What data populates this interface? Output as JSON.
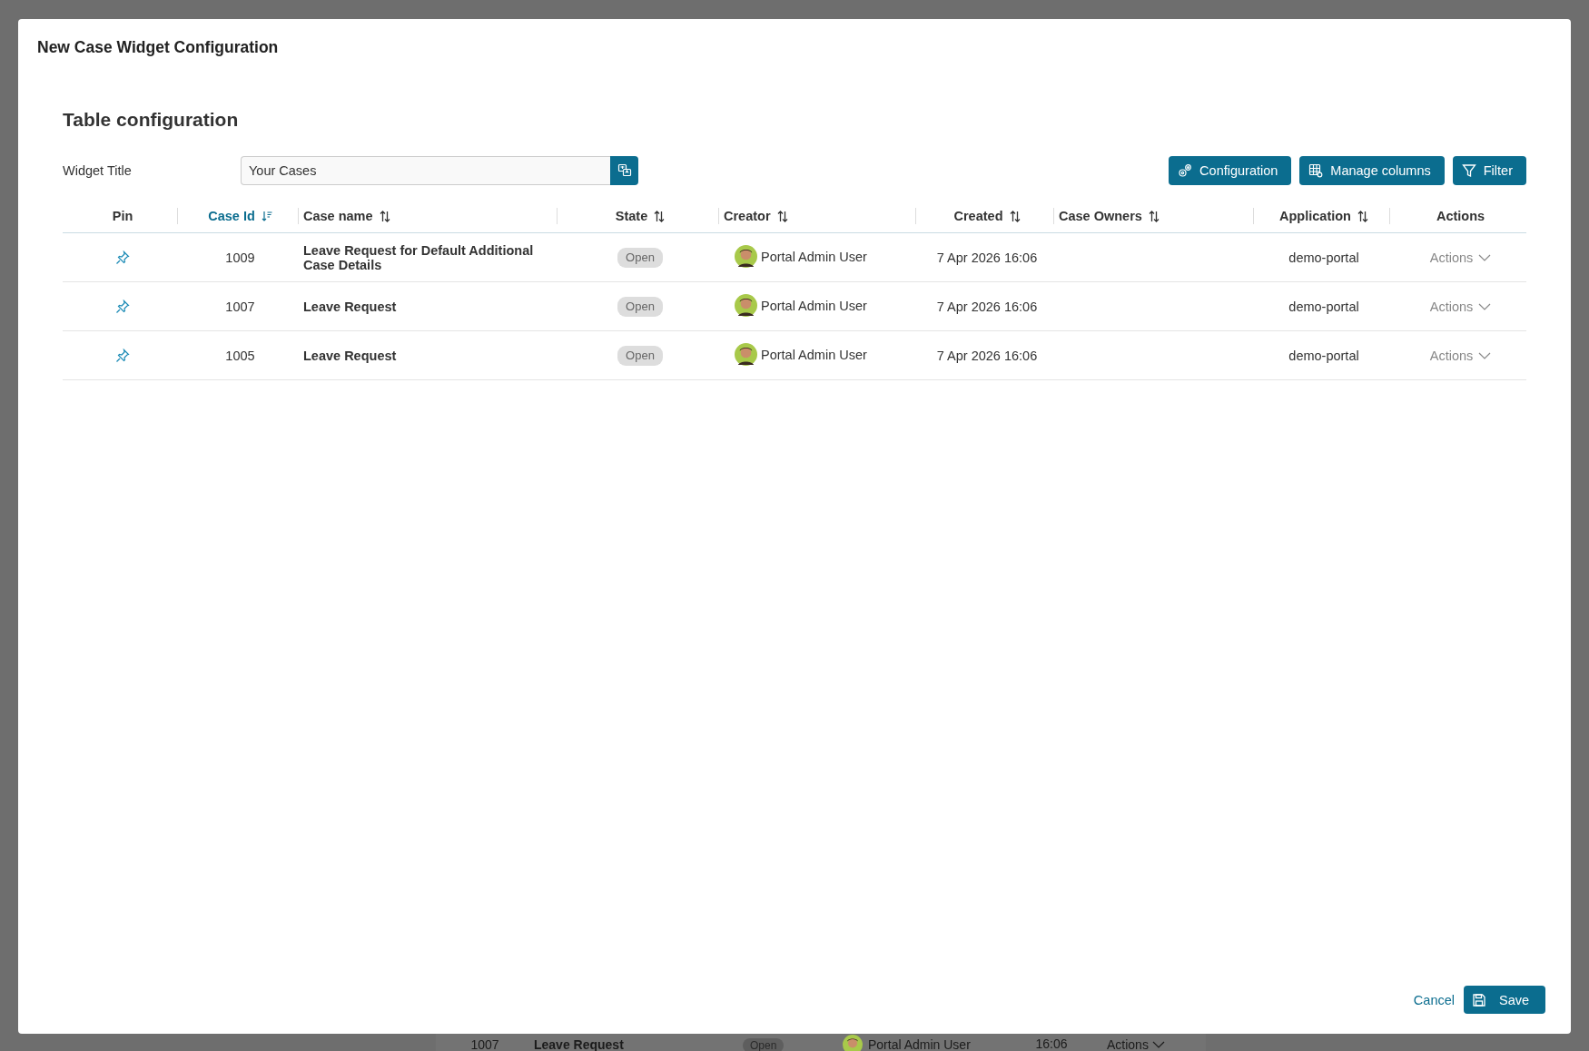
{
  "background_row": {
    "case_id": "1007",
    "case_name": "Leave Request",
    "state": "Open",
    "creator": "Portal Admin User",
    "created": "16:06",
    "actions": "Actions"
  },
  "dialog": {
    "title": "New Case Widget Configuration",
    "section_title": "Table configuration",
    "widget_title": {
      "label": "Widget Title",
      "value": "Your Cases"
    },
    "toolbar_buttons": [
      {
        "label": "Configuration",
        "kind": "gear"
      },
      {
        "label": "Manage columns",
        "kind": "grid"
      },
      {
        "label": "Filter",
        "kind": "filter"
      }
    ],
    "table": {
      "columns": [
        {
          "label": "Pin",
          "sortable": false,
          "selected": false
        },
        {
          "label": "Case Id",
          "sortable": true,
          "selected": true
        },
        {
          "label": "Case name",
          "sortable": true,
          "selected": false
        },
        {
          "label": "State",
          "sortable": true,
          "selected": false
        },
        {
          "label": "Creator",
          "sortable": true,
          "selected": false
        },
        {
          "label": "Created",
          "sortable": true,
          "selected": false
        },
        {
          "label": "Case Owners",
          "sortable": true,
          "selected": false
        },
        {
          "label": "Application",
          "sortable": true,
          "selected": false
        },
        {
          "label": "Actions",
          "sortable": false,
          "selected": false
        }
      ],
      "rows": [
        {
          "case_id": "1009",
          "case_name": "Leave Request for Default Additional Case Details",
          "state": "Open",
          "creator": "Portal Admin User",
          "created": "7 Apr 2026 16:06",
          "application": "demo-portal",
          "actions": "Actions"
        },
        {
          "case_id": "1007",
          "case_name": "Leave Request",
          "state": "Open",
          "creator": "Portal Admin User",
          "created": "7 Apr 2026 16:06",
          "application": "demo-portal",
          "actions": "Actions"
        },
        {
          "case_id": "1005",
          "case_name": "Leave Request",
          "state": "Open",
          "creator": "Portal Admin User",
          "created": "7 Apr 2026 16:06",
          "application": "demo-portal",
          "actions": "Actions"
        }
      ]
    },
    "footer": {
      "cancel": "Cancel",
      "save": "Save"
    }
  }
}
